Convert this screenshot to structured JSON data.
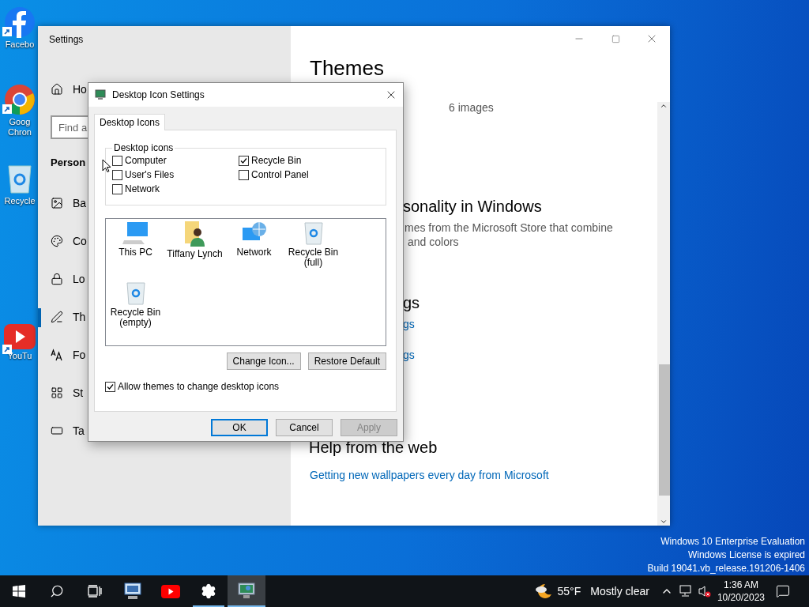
{
  "desktop_icons": [
    {
      "label": "Facebo",
      "kind": "facebook",
      "shortcut": true
    },
    {
      "label": "Goog\nChron",
      "kind": "chrome",
      "shortcut": true
    },
    {
      "label": "Recycle",
      "kind": "recycle",
      "shortcut": false
    },
    {
      "label": "YouTu",
      "kind": "youtube",
      "shortcut": true
    }
  ],
  "settings": {
    "title": "Settings",
    "sidebar": {
      "home": "Ho",
      "search_placeholder": "Find a",
      "section": "Person",
      "items": [
        {
          "label": "Ba",
          "kind": "background",
          "selected": false
        },
        {
          "label": "Co",
          "kind": "colors",
          "selected": false
        },
        {
          "label": "Lo",
          "kind": "lock",
          "selected": false
        },
        {
          "label": "Th",
          "kind": "themes",
          "selected": true
        },
        {
          "label": "Fo",
          "kind": "fonts",
          "selected": false
        },
        {
          "label": "St",
          "kind": "start",
          "selected": false
        },
        {
          "label": "Ta",
          "kind": "taskbar",
          "selected": false
        }
      ]
    },
    "content": {
      "title": "Themes",
      "theme_count": "6 images",
      "store_heading": "sonality in Windows",
      "store_text": [
        "mes from the Microsoft Store that combine",
        "and colors"
      ],
      "related_heading": "gs",
      "related_links": [
        "gs",
        "gs"
      ],
      "help_heading": "Help from the web",
      "help_link": "Getting new wallpapers every day from Microsoft"
    }
  },
  "dialog": {
    "title": "Desktop Icon Settings",
    "tabs": [
      {
        "label": "Desktop Icons",
        "selected": true
      }
    ],
    "group": {
      "label": "Desktop icons",
      "checkboxes": [
        {
          "label": "Computer",
          "checked": false
        },
        {
          "label": "Recycle Bin",
          "checked": true
        },
        {
          "label": "User's Files",
          "checked": false
        },
        {
          "label": "Control Panel",
          "checked": false
        },
        {
          "label": "Network",
          "checked": false
        }
      ]
    },
    "icons": [
      {
        "label": "This PC",
        "kind": "pc"
      },
      {
        "label": "Tiffany Lynch",
        "kind": "user"
      },
      {
        "label": "Network",
        "kind": "network"
      },
      {
        "label": "Recycle Bin (full)",
        "kind": "bin"
      },
      {
        "label": "Recycle Bin (empty)",
        "kind": "bin"
      }
    ],
    "icon_buttons": [
      "Change Icon...",
      "Restore Default"
    ],
    "allow_themes": {
      "label": "Allow themes to change desktop icons",
      "checked": true
    },
    "buttons": [
      {
        "label": "OK",
        "default": true,
        "disabled": false
      },
      {
        "label": "Cancel",
        "default": false,
        "disabled": false
      },
      {
        "label": "Apply",
        "default": false,
        "disabled": true
      }
    ]
  },
  "watermark": [
    "Windows 10 Enterprise Evaluation",
    "Windows License is expired",
    "Build 19041.vb_release.191206-1406"
  ],
  "taskbar": {
    "apps": [
      {
        "kind": "remote",
        "running": false,
        "active": false
      },
      {
        "kind": "youtube",
        "running": false,
        "active": false
      },
      {
        "kind": "gear",
        "running": true,
        "active": false
      },
      {
        "kind": "display",
        "running": true,
        "active": true
      }
    ],
    "weather": {
      "temperature": "55°F",
      "condition": "Mostly clear"
    },
    "clock": {
      "time": "1:36 AM",
      "date": "10/20/2023"
    }
  }
}
